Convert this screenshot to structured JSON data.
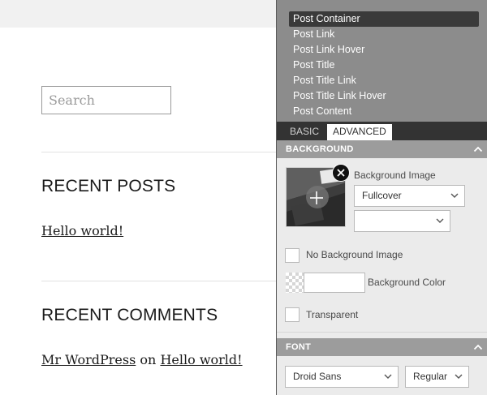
{
  "site": {
    "search_placeholder": "Search",
    "recent_posts": {
      "title": "RECENT POSTS",
      "items": [
        "Hello world!"
      ]
    },
    "recent_comments": {
      "title": "RECENT COMMENTS",
      "author": "Mr WordPress",
      "connector": "on",
      "post": "Hello world!"
    }
  },
  "panel": {
    "selectors": [
      "Post Container",
      "Post Link",
      "Post Link Hover",
      "Post Title",
      "Post Title Link",
      "Post Title Link Hover",
      "Post Content"
    ],
    "active_selector": "Post Container",
    "tabs": [
      "BASIC",
      "ADVANCED"
    ],
    "active_tab": "ADVANCED",
    "background": {
      "section_title": "BACKGROUND",
      "image_label": "Background Image",
      "size_value": "Fullcover",
      "position_value": "",
      "no_image_label": "No Background Image",
      "no_image_checked": false,
      "color_label": "Background Color",
      "color_value": "",
      "transparent_label": "Transparent",
      "transparent_checked": false
    },
    "font": {
      "section_title": "FONT",
      "family_value": "Droid Sans",
      "weight_value": "Regular"
    }
  },
  "icons": {
    "collapse": "chevron-up-icon",
    "dropdown": "chevron-down-icon",
    "remove": "close-icon",
    "add": "plus-icon"
  },
  "colors": {
    "panel_bg": "#ebebeb",
    "selector_bg": "#8c8c8c",
    "selector_active": "#3a3a3a",
    "tabbar_bg": "#333333",
    "section_head_bg": "#9c9c9c"
  }
}
